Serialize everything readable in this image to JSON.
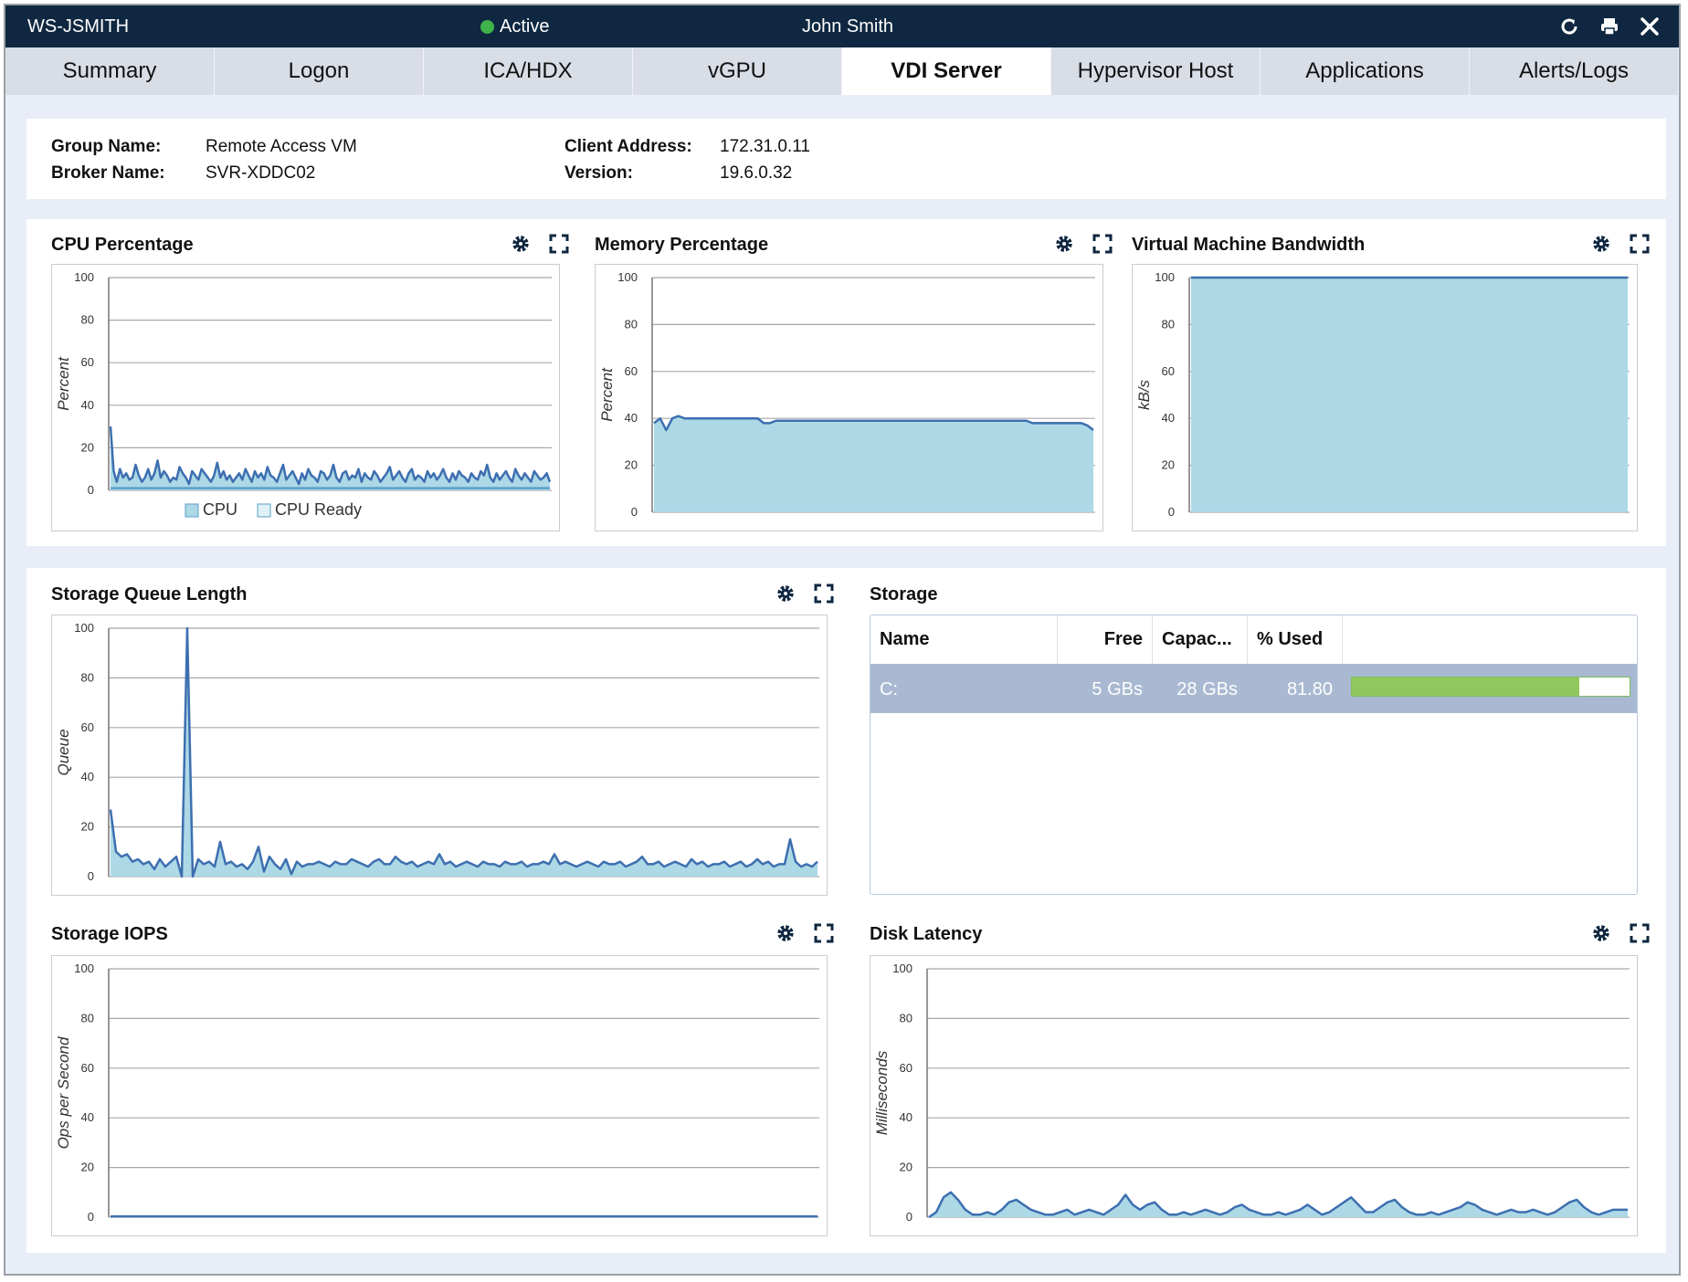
{
  "window": {
    "title": "WS-JSMITH",
    "status": "Active",
    "user": "John Smith"
  },
  "toolbar": {
    "refresh_icon": "refresh-icon",
    "print_icon": "print-icon",
    "close_icon": "close-icon"
  },
  "tabs": [
    {
      "label": "Summary",
      "active": false
    },
    {
      "label": "Logon",
      "active": false
    },
    {
      "label": "ICA/HDX",
      "active": false
    },
    {
      "label": "vGPU",
      "active": false
    },
    {
      "label": "VDI Server",
      "active": true
    },
    {
      "label": "Hypervisor Host",
      "active": false
    },
    {
      "label": "Applications",
      "active": false
    },
    {
      "label": "Alerts/Logs",
      "active": false
    }
  ],
  "info": {
    "group_name_label": "Group Name:",
    "group_name": "Remote Access VM",
    "broker_name_label": "Broker Name:",
    "broker_name": "SVR-XDDC02",
    "client_address_label": "Client Address:",
    "client_address": "172.31.0.11",
    "version_label": "Version:",
    "version": "19.6.0.32"
  },
  "colors": {
    "fill": "#add8e6",
    "line": "#3d6fb0",
    "grid": "#a8a8a8"
  },
  "panels": {
    "cpu": {
      "title": "CPU Percentage",
      "legend": [
        "CPU",
        "CPU Ready"
      ]
    },
    "memory": {
      "title": "Memory Percentage"
    },
    "bandwidth": {
      "title": "Virtual Machine Bandwidth"
    },
    "queue": {
      "title": "Storage Queue Length"
    },
    "storage": {
      "title": "Storage"
    },
    "iops": {
      "title": "Storage IOPS"
    },
    "latency": {
      "title": "Disk Latency"
    }
  },
  "storage_table": {
    "headers": [
      "Name",
      "Free",
      "Capac...",
      "% Used"
    ],
    "rows": [
      {
        "name": "C:",
        "free": "5 GBs",
        "capacity": "28 GBs",
        "used": "81.80",
        "used_fraction": 0.818
      }
    ]
  },
  "chart_data": [
    {
      "id": "cpu",
      "type": "area",
      "title": "CPU Percentage",
      "ylabel": "Percent",
      "ylim": [
        0,
        100
      ],
      "yticks": [
        0,
        20,
        40,
        60,
        80,
        100
      ],
      "series": [
        {
          "name": "CPU",
          "values": [
            30,
            9,
            4,
            10,
            6,
            8,
            5,
            6,
            12,
            7,
            4,
            6,
            10,
            5,
            8,
            14,
            6,
            9,
            7,
            4,
            6,
            5,
            11,
            8,
            6,
            3,
            9,
            7,
            5,
            10,
            8,
            6,
            4,
            7,
            13,
            6,
            9,
            5,
            7,
            4,
            6,
            8,
            5,
            10,
            7,
            4,
            9,
            6,
            8,
            5,
            11,
            7,
            6,
            4,
            8,
            12,
            5,
            7,
            9,
            6,
            3,
            8,
            5,
            10,
            7,
            6,
            4,
            9,
            8,
            5,
            7,
            12,
            6,
            4,
            8,
            9,
            5,
            7,
            6,
            10,
            4,
            8,
            6,
            5,
            9,
            7,
            4,
            6,
            8,
            11,
            5,
            7,
            9,
            6,
            4,
            8,
            10,
            5,
            7,
            6,
            4,
            9,
            6,
            8,
            5,
            7,
            10,
            6,
            4,
            8,
            5,
            9,
            7,
            6,
            4,
            8,
            6,
            5,
            9,
            7,
            12,
            6,
            4,
            8,
            5,
            7,
            9,
            6,
            4,
            10,
            7,
            5,
            8,
            6,
            4,
            9,
            7,
            5,
            6,
            8,
            4
          ]
        },
        {
          "name": "CPU Ready",
          "values": [
            1,
            1,
            1,
            1,
            1,
            1,
            1,
            1,
            1,
            1,
            1,
            1
          ]
        }
      ]
    },
    {
      "id": "memory",
      "type": "area",
      "title": "Memory Percentage",
      "ylabel": "Percent",
      "ylim": [
        0,
        100
      ],
      "yticks": [
        0,
        20,
        40,
        60,
        80,
        100
      ],
      "series": [
        {
          "name": "Memory",
          "values": [
            38,
            40,
            35,
            40,
            41,
            40,
            40,
            40,
            40,
            40,
            40,
            40,
            40,
            40,
            40,
            40,
            40,
            40,
            38,
            38,
            39,
            39,
            39,
            39,
            39,
            39,
            39,
            39,
            39,
            39,
            39,
            39,
            39,
            39,
            39,
            39,
            39,
            39,
            39,
            39,
            39,
            39,
            39,
            39,
            39,
            39,
            39,
            39,
            39,
            39,
            39,
            39,
            39,
            39,
            39,
            39,
            39,
            39,
            39,
            39,
            39,
            39,
            38,
            38,
            38,
            38,
            38,
            38,
            38,
            38,
            38,
            37,
            35
          ]
        }
      ]
    },
    {
      "id": "bandwidth",
      "type": "area",
      "title": "Virtual Machine Bandwidth",
      "ylabel": "kB/s",
      "ylim": [
        0,
        100
      ],
      "yticks": [
        0,
        20,
        40,
        60,
        80,
        100
      ],
      "series": [
        {
          "name": "Bandwidth",
          "values": [
            100,
            100,
            100,
            100
          ]
        }
      ]
    },
    {
      "id": "queue",
      "type": "area",
      "title": "Storage Queue Length",
      "ylabel": "Queue",
      "ylim": [
        0,
        100
      ],
      "yticks": [
        0,
        20,
        40,
        60,
        80,
        100
      ],
      "series": [
        {
          "name": "Queue",
          "values": [
            27,
            10,
            8,
            9,
            6,
            7,
            5,
            6,
            3,
            7,
            4,
            6,
            8,
            0,
            100,
            0,
            7,
            5,
            6,
            4,
            14,
            5,
            6,
            4,
            5,
            3,
            6,
            12,
            2,
            8,
            5,
            3,
            7,
            1,
            6,
            4,
            5,
            5,
            6,
            5,
            4,
            6,
            5,
            5,
            7,
            6,
            5,
            4,
            6,
            7,
            5,
            5,
            8,
            6,
            5,
            6,
            4,
            5,
            6,
            5,
            9,
            5,
            6,
            4,
            5,
            6,
            5,
            4,
            6,
            5,
            5,
            4,
            6,
            5,
            5,
            6,
            4,
            5,
            5,
            6,
            5,
            9,
            5,
            6,
            5,
            4,
            5,
            6,
            5,
            4,
            6,
            5,
            5,
            6,
            4,
            5,
            6,
            8,
            5,
            5,
            6,
            4,
            5,
            6,
            5,
            4,
            7,
            5,
            6,
            4,
            5,
            5,
            6,
            4,
            5,
            6,
            4,
            5,
            7,
            5,
            6,
            4,
            5,
            5,
            15,
            6,
            4,
            5,
            4,
            6
          ]
        }
      ]
    },
    {
      "id": "iops",
      "type": "area",
      "title": "Storage IOPS",
      "ylabel": "Ops per Second",
      "ylim": [
        0,
        100
      ],
      "yticks": [
        0,
        20,
        40,
        60,
        80,
        100
      ],
      "series": [
        {
          "name": "IOPS",
          "values": [
            0.3,
            0.3,
            0.3,
            0.3,
            0.3,
            0.3,
            0.3,
            0.3,
            0.3,
            0.3
          ]
        }
      ]
    },
    {
      "id": "latency",
      "type": "area",
      "title": "Disk Latency",
      "ylabel": "Milliseconds",
      "ylim": [
        0,
        100
      ],
      "yticks": [
        0,
        20,
        40,
        60,
        80,
        100
      ],
      "series": [
        {
          "name": "Latency",
          "values": [
            0,
            2,
            8,
            10,
            7,
            3,
            1,
            1,
            2,
            1,
            3,
            6,
            7,
            5,
            3,
            2,
            1,
            1,
            2,
            3,
            1,
            2,
            3,
            2,
            1,
            3,
            5,
            9,
            5,
            3,
            5,
            6,
            3,
            1,
            1,
            2,
            1,
            2,
            3,
            2,
            1,
            2,
            4,
            5,
            3,
            2,
            1,
            1,
            2,
            1,
            2,
            3,
            5,
            3,
            1,
            2,
            4,
            6,
            8,
            5,
            2,
            2,
            4,
            6,
            7,
            4,
            2,
            1,
            1,
            2,
            1,
            2,
            3,
            4,
            6,
            5,
            3,
            2,
            1,
            2,
            3,
            2,
            2,
            3,
            2,
            1,
            2,
            4,
            6,
            7,
            4,
            2,
            1,
            2,
            3,
            3,
            3
          ]
        }
      ]
    }
  ]
}
